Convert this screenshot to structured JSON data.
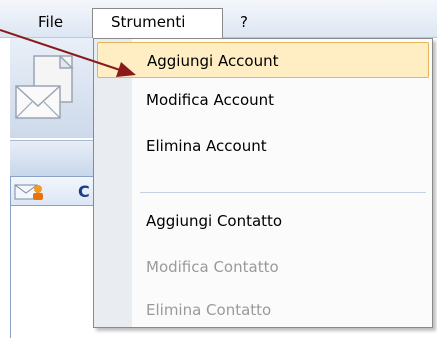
{
  "menubar": {
    "file_label": "File",
    "tools_label": "Strumenti",
    "help_label": "?"
  },
  "background_panel": {
    "header_letter": "C"
  },
  "dropdown": {
    "items": [
      {
        "label": "Aggiungi Account",
        "enabled": true,
        "highlighted": true
      },
      {
        "label": "Modifica Account",
        "enabled": true
      },
      {
        "label": "Elimina Account",
        "enabled": true
      },
      {
        "label": "Aggiungi Contatto",
        "enabled": true
      },
      {
        "label": "Modifica Contatto",
        "enabled": false
      },
      {
        "label": "Elimina Contatto",
        "enabled": false
      }
    ]
  },
  "colors": {
    "highlight_fill": "#ffeec4",
    "highlight_border": "#e7b55a",
    "arrow": "#8b1a1a",
    "disabled_text": "#9a9a9a"
  },
  "icons": [
    "envelope-icon",
    "contacts-envelope-icon",
    "annotation-arrow"
  ]
}
